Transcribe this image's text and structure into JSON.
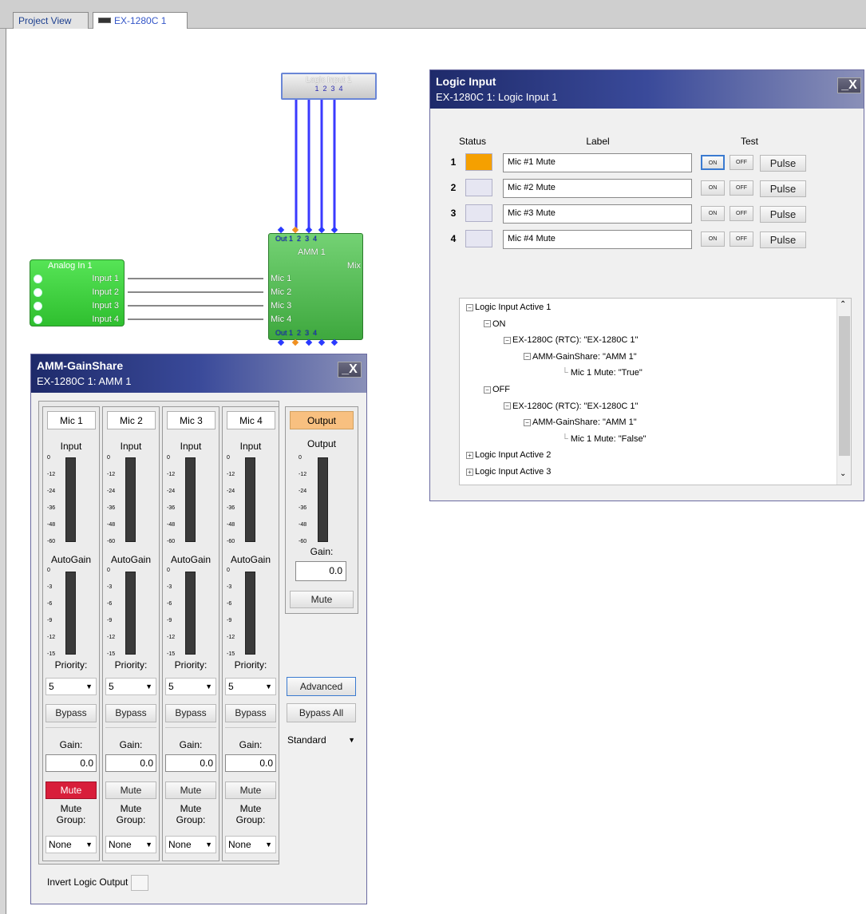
{
  "tabs": [
    {
      "label": "Project View"
    },
    {
      "label": "EX-1280C 1"
    }
  ],
  "diagram": {
    "logic_block": {
      "title": "Logic Input 1",
      "ports": [
        "1",
        "2",
        "3",
        "4"
      ]
    },
    "analog_block": {
      "title": "Analog In 1",
      "inputs": [
        "Input 1",
        "Input 2",
        "Input 3",
        "Input 4"
      ]
    },
    "amm_block": {
      "title": "AMM 1",
      "mix_label": "Mix",
      "top_out": "Out 1",
      "top_nums": [
        "2",
        "3",
        "4"
      ],
      "mics": [
        "Mic 1",
        "Mic 2",
        "Mic 3",
        "Mic 4"
      ],
      "bottom_out": "Out 1",
      "bottom_nums": [
        "2",
        "3",
        "4"
      ]
    }
  },
  "logic_window": {
    "title": "Logic Input",
    "subtitle": "EX-1280C 1: Logic Input 1",
    "close": "_X",
    "headers": {
      "status": "Status",
      "label": "Label",
      "test": "Test"
    },
    "rows": [
      {
        "num": "1",
        "label": "Mic #1 Mute",
        "status_color": "#f5a000"
      },
      {
        "num": "2",
        "label": "Mic #2 Mute",
        "status_color": "#e6e6f2"
      },
      {
        "num": "3",
        "label": "Mic #3 Mute",
        "status_color": "#e6e6f2"
      },
      {
        "num": "4",
        "label": "Mic #4 Mute",
        "status_color": "#e6e6f2"
      }
    ],
    "btn_on": "ON",
    "btn_off": "OFF",
    "btn_pulse": "Pulse",
    "tree": [
      {
        "text": "Logic Input Active 1",
        "box": "−",
        "cls": "orange"
      },
      {
        "text": "ON",
        "box": "−",
        "cls": ""
      },
      {
        "text": "EX-1280C (RTC): \"EX-1280C 1\"",
        "box": "−",
        "cls": ""
      },
      {
        "text": "AMM-GainShare: \"AMM 1\"",
        "box": "−",
        "cls": ""
      },
      {
        "text": "Mic 1 Mute: \"True\"",
        "box": "",
        "cls": "purple"
      },
      {
        "text": "OFF",
        "box": "−",
        "cls": ""
      },
      {
        "text": "EX-1280C (RTC): \"EX-1280C 1\"",
        "box": "−",
        "cls": ""
      },
      {
        "text": "AMM-GainShare: \"AMM 1\"",
        "box": "−",
        "cls": ""
      },
      {
        "text": "Mic 1 Mute: \"False\"",
        "box": "",
        "cls": "purple"
      },
      {
        "text": "Logic Input Active 2",
        "box": "+",
        "cls": "orange"
      },
      {
        "text": "Logic Input Active 3",
        "box": "+",
        "cls": "orange"
      }
    ]
  },
  "amm_window": {
    "title": "AMM-GainShare",
    "subtitle": "EX-1280C 1: AMM 1",
    "close": "_X",
    "channels": [
      {
        "name": "Mic 1",
        "input": "Input",
        "autogain": "AutoGain",
        "priority_label": "Priority:",
        "priority": "5",
        "bypass": "Bypass",
        "gain_label": "Gain:",
        "gain": "0.0",
        "mute": "Mute",
        "muted": true,
        "mute_group": "Mute Group:",
        "group": "None"
      },
      {
        "name": "Mic 2",
        "input": "Input",
        "autogain": "AutoGain",
        "priority_label": "Priority:",
        "priority": "5",
        "bypass": "Bypass",
        "gain_label": "Gain:",
        "gain": "0.0",
        "mute": "Mute",
        "muted": false,
        "mute_group": "Mute Group:",
        "group": "None"
      },
      {
        "name": "Mic 3",
        "input": "Input",
        "autogain": "AutoGain",
        "priority_label": "Priority:",
        "priority": "5",
        "bypass": "Bypass",
        "gain_label": "Gain:",
        "gain": "0.0",
        "mute": "Mute",
        "muted": false,
        "mute_group": "Mute Group:",
        "group": "None"
      },
      {
        "name": "Mic 4",
        "input": "Input",
        "autogain": "AutoGain",
        "priority_label": "Priority:",
        "priority": "5",
        "bypass": "Bypass",
        "gain_label": "Gain:",
        "gain": "0.0",
        "mute": "Mute",
        "muted": false,
        "mute_group": "Mute Group:",
        "group": "None"
      }
    ],
    "input_ticks": [
      "0",
      "-12",
      "-24",
      "-36",
      "-48",
      "-60"
    ],
    "autogain_ticks": [
      "0",
      "-3",
      "-6",
      "-9",
      "-12",
      "-15"
    ],
    "output": {
      "header": "Output",
      "meter_label": "Output",
      "gain_label": "Gain:",
      "gain": "0.0",
      "mute": "Mute"
    },
    "advanced": "Advanced",
    "bypass_all": "Bypass All",
    "mode": "Standard",
    "invert_label": "Invert Logic Output"
  }
}
